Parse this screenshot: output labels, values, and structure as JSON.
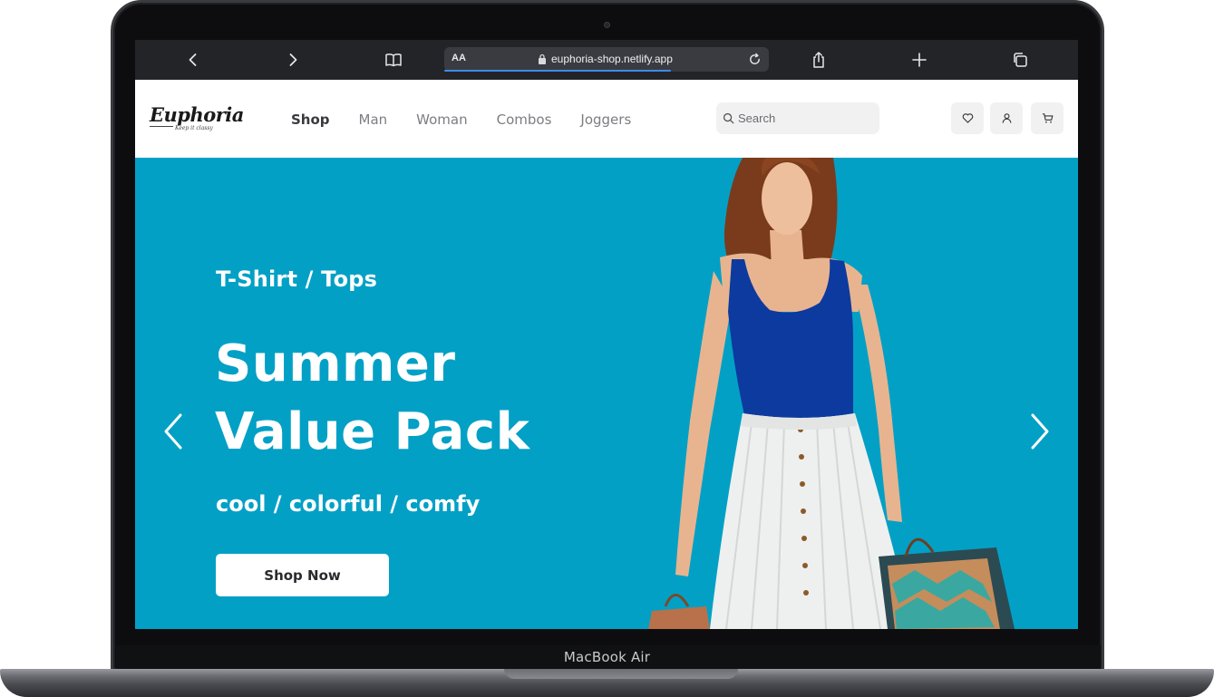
{
  "device": {
    "model_label": "MacBook Air"
  },
  "browser": {
    "text_size_label": "AA",
    "url": "euphoria-shop.netlify.app",
    "icons": [
      "back-icon",
      "forward-icon",
      "bookmarks-icon",
      "lock-icon",
      "reload-icon",
      "share-icon",
      "new-tab-icon",
      "tabs-icon"
    ]
  },
  "site": {
    "logo": {
      "name": "Euphoria",
      "tagline": "Keep it classy"
    },
    "nav": {
      "items": [
        {
          "label": "Shop",
          "active": true
        },
        {
          "label": "Man",
          "active": false
        },
        {
          "label": "Woman",
          "active": false
        },
        {
          "label": "Combos",
          "active": false
        },
        {
          "label": "Joggers",
          "active": false
        }
      ]
    },
    "search": {
      "placeholder": "Search"
    },
    "header_icons": [
      "heart-icon",
      "user-icon",
      "cart-icon"
    ]
  },
  "hero": {
    "subtitle": "T-Shirt / Tops",
    "title": "Summer Value Pack",
    "tagline": "cool / colorful / comfy",
    "cta_label": "Shop Now",
    "background_color": "#03a0c6"
  }
}
